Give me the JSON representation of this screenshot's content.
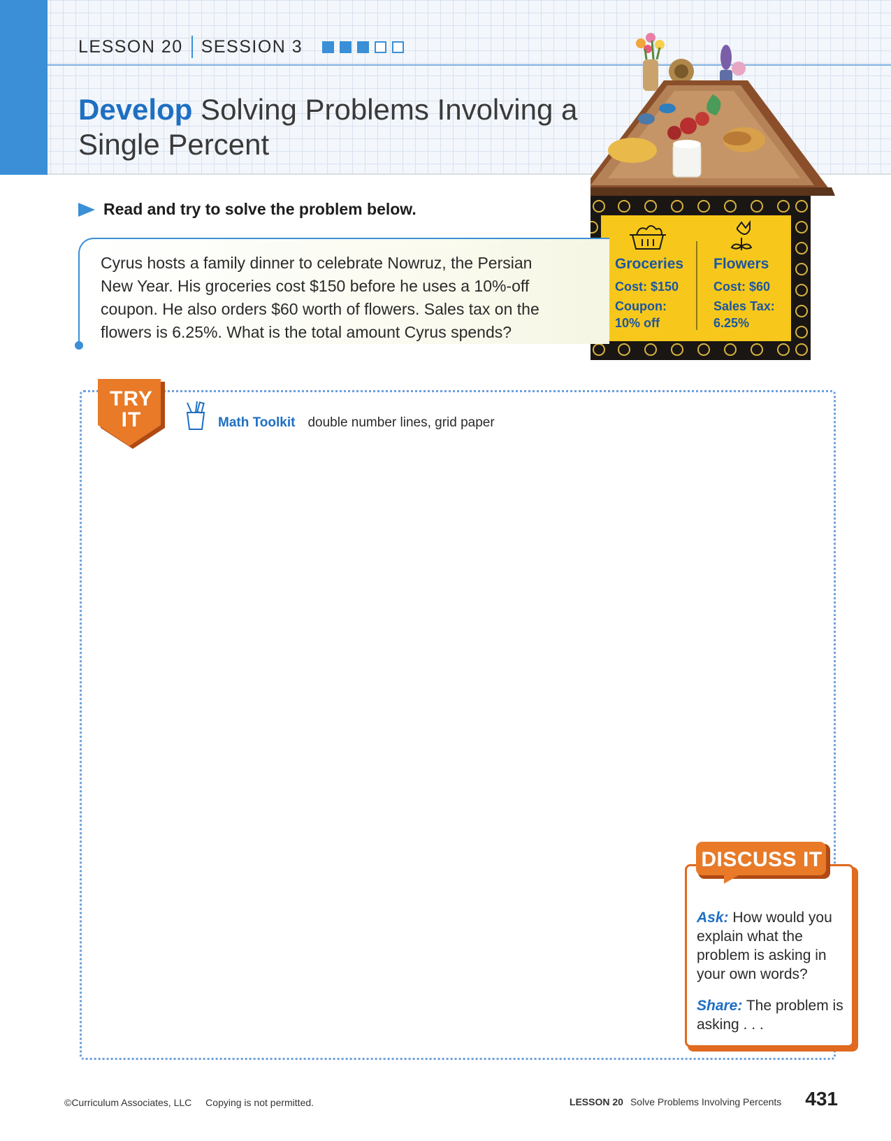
{
  "header": {
    "lesson": "LESSON 20",
    "session": "SESSION 3",
    "progress": [
      true,
      true,
      true,
      false,
      false
    ],
    "title_bold": "Develop",
    "title_rest": " Solving Problems Involving a Single Percent"
  },
  "instruction": "Read and try to solve the problem below.",
  "problem": "Cyrus hosts a family dinner to celebrate Nowruz, the Persian New Year. His groceries cost $150 before he uses a 10%-off coupon. He also orders $60 worth of flowers. Sales tax on the flowers is 6.25%. What is the total amount Cyrus spends?",
  "sign": {
    "groceries": {
      "title": "Groceries",
      "cost": "Cost: $150",
      "coupon_label": "Coupon:",
      "coupon_value": "10% off"
    },
    "flowers": {
      "title": "Flowers",
      "cost": "Cost: $60",
      "tax_label": "Sales Tax:",
      "tax_value": "6.25%"
    }
  },
  "try_it": {
    "badge": "TRY IT",
    "toolkit_label": "Math Toolkit",
    "toolkit_items": "double number lines, grid paper"
  },
  "discuss": {
    "tag": "DISCUSS IT",
    "ask_label": "Ask:",
    "ask_text": " How would you explain what the problem is asking in your own words?",
    "share_label": "Share:",
    "share_text": " The problem is asking . . ."
  },
  "footer": {
    "copyright": "©Curriculum Associates, LLC",
    "notice": "Copying is not permitted.",
    "lesson": "LESSON 20",
    "lesson_title": "Solve Problems Involving Percents",
    "page": "431"
  },
  "colors": {
    "brand_blue": "#3a8fd6",
    "orange": "#e06a1f",
    "sign_yellow": "#f7c81b"
  }
}
